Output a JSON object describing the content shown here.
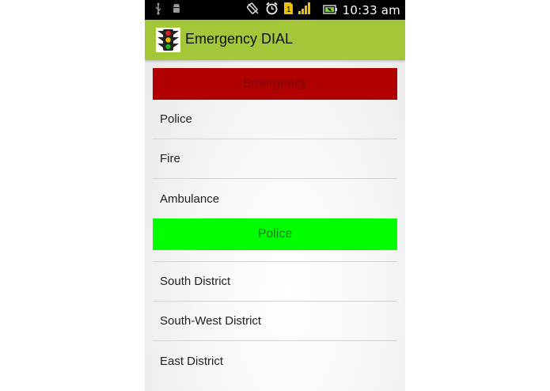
{
  "status_bar": {
    "time": "10:33 am",
    "left_icons": [
      "usb-icon",
      "android-debug-icon"
    ],
    "right_icons": [
      "rotation-lock-icon",
      "alarm-icon",
      "sim-icon",
      "signal-icon",
      "battery-icon"
    ]
  },
  "action_bar": {
    "title": "Emergency DIAL",
    "icon": "traffic-light-icon",
    "color": "#a4c639"
  },
  "sections": [
    {
      "header": "Emergency",
      "header_color": "#b10000",
      "items": [
        "Police",
        "Fire",
        "Ambulance"
      ]
    },
    {
      "header": "Police",
      "header_color": "#00ff00",
      "items": [
        "South District",
        "South-West District",
        "East District"
      ]
    }
  ]
}
